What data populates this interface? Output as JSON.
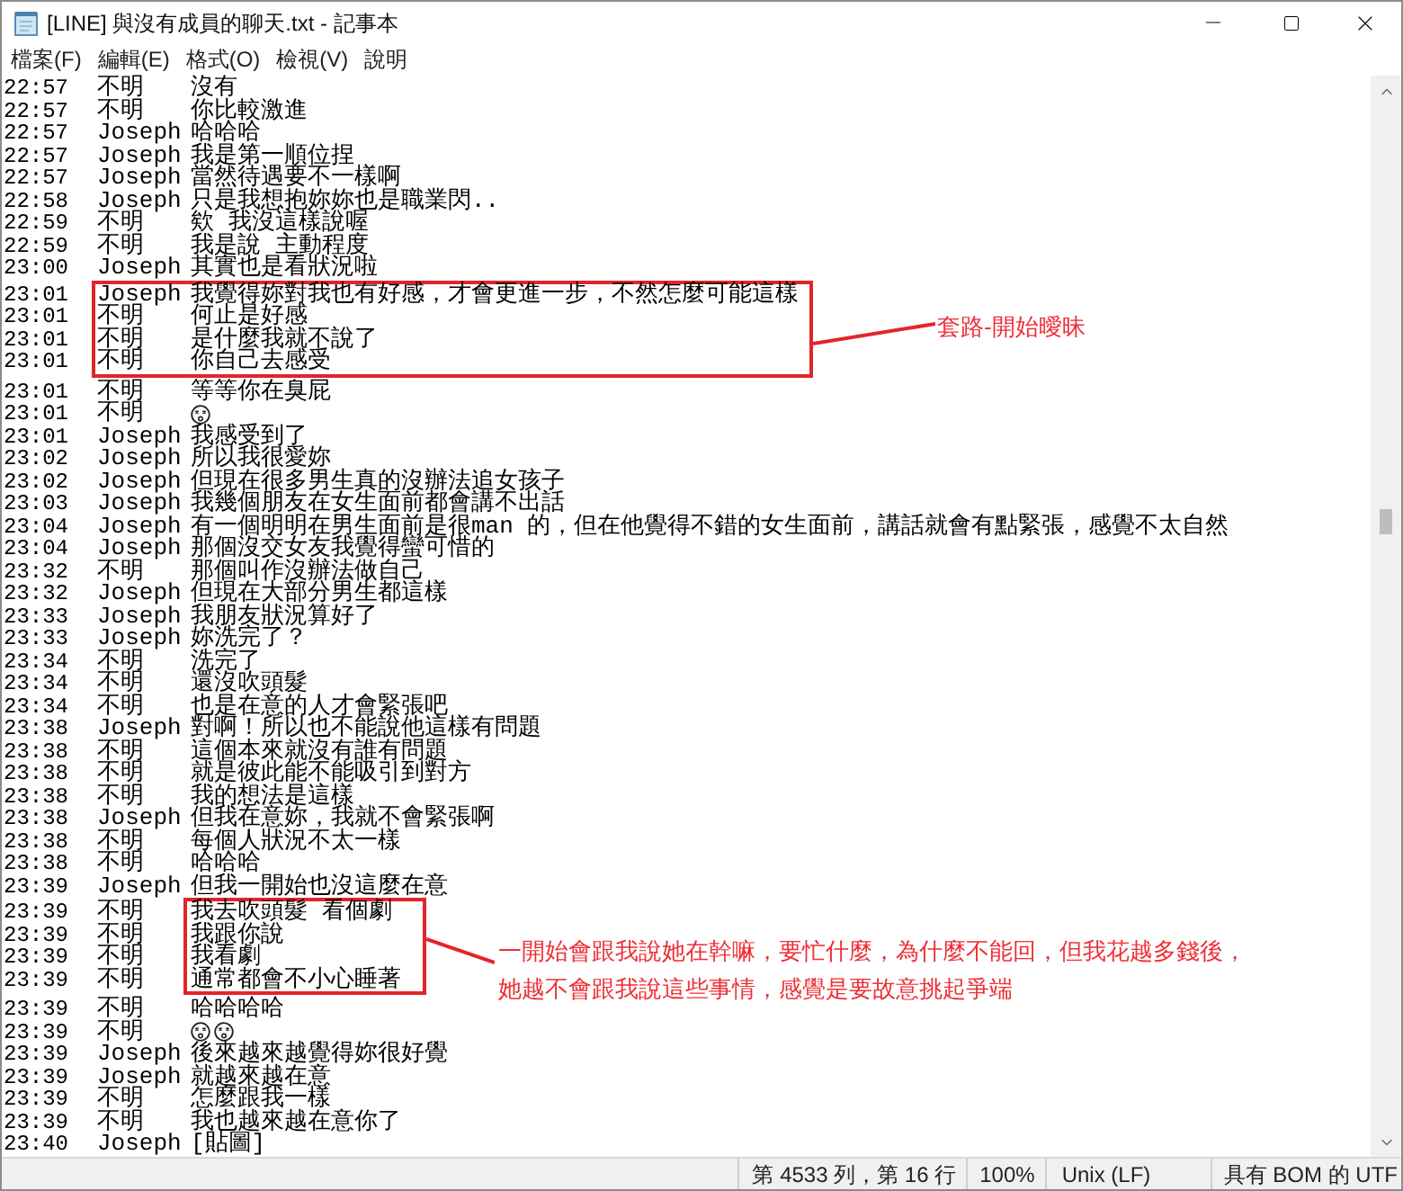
{
  "window": {
    "title": "[LINE] 與沒有成員的聊天.txt - 記事本"
  },
  "menu": [
    "檔案(F)",
    "編輯(E)",
    "格式(O)",
    "檢視(V)",
    "說明"
  ],
  "text_area": {
    "blocks": [
      {
        "kind": "plain",
        "lines": [
          {
            "kind": "text",
            "time": "22:57",
            "sender": "不明",
            "text": "沒有"
          },
          {
            "kind": "text",
            "time": "22:57",
            "sender": "不明",
            "text": "你比較激進"
          },
          {
            "kind": "text",
            "time": "22:57",
            "sender": "Joseph",
            "text": "哈哈哈"
          },
          {
            "kind": "text",
            "time": "22:57",
            "sender": "Joseph",
            "text": "我是第一順位捏"
          },
          {
            "kind": "text",
            "time": "22:57",
            "sender": "Joseph",
            "text": "當然待遇要不一樣啊"
          },
          {
            "kind": "text",
            "time": "22:58",
            "sender": "Joseph",
            "text": "只是我想抱妳妳也是職業閃.."
          },
          {
            "kind": "text",
            "time": "22:59",
            "sender": "不明",
            "text": "欸 我沒這樣說喔"
          },
          {
            "kind": "text",
            "time": "22:59",
            "sender": "不明",
            "text": "我是說 主動程度"
          },
          {
            "kind": "text",
            "time": "23:00",
            "sender": "Joseph",
            "text": "其實也是看狀況啦"
          }
        ]
      },
      {
        "kind": "frame",
        "note": [
          "套路-開始曖昧"
        ],
        "lines": [
          {
            "kind": "text",
            "time": "23:01",
            "sender": "Joseph",
            "text": "我覺得妳對我也有好感，才會更進一步，不然怎麼可能這樣"
          },
          {
            "kind": "text",
            "time": "23:01",
            "sender": "不明",
            "text": "何止是好感"
          },
          {
            "kind": "text",
            "time": "23:01",
            "sender": "不明",
            "text": "是什麼我就不說了"
          },
          {
            "kind": "text",
            "time": "23:01",
            "sender": "不明",
            "text": "你自己去感受"
          }
        ]
      },
      {
        "kind": "plain",
        "lines": [
          {
            "kind": "text",
            "time": "23:01",
            "sender": "不明",
            "text": "等等你在臭屁"
          },
          {
            "kind": "emoji",
            "time": "23:01",
            "sender": "不明",
            "emoji": [
              {
                "kind": "face"
              }
            ]
          },
          {
            "kind": "text",
            "time": "23:01",
            "sender": "Joseph",
            "text": "我感受到了"
          },
          {
            "kind": "text",
            "time": "23:02",
            "sender": "Joseph",
            "text": "所以我很愛妳"
          },
          {
            "kind": "text",
            "time": "23:02",
            "sender": "Joseph",
            "text": "但現在很多男生真的沒辦法追女孩子"
          },
          {
            "kind": "text",
            "time": "23:03",
            "sender": "Joseph",
            "text": "我幾個朋友在女生面前都會講不出話"
          },
          {
            "kind": "text",
            "time": "23:04",
            "sender": "Joseph",
            "text": "有一個明明在男生面前是很man 的，但在他覺得不錯的女生面前，講話就會有點緊張，感覺不太自然"
          },
          {
            "kind": "text",
            "time": "23:04",
            "sender": "Joseph",
            "text": "那個沒交女友我覺得蠻可惜的"
          },
          {
            "kind": "text",
            "time": "23:32",
            "sender": "不明",
            "text": "那個叫作沒辦法做自己"
          },
          {
            "kind": "text",
            "time": "23:32",
            "sender": "Joseph",
            "text": "但現在大部分男生都這樣"
          },
          {
            "kind": "text",
            "time": "23:33",
            "sender": "Joseph",
            "text": "我朋友狀況算好了"
          },
          {
            "kind": "text",
            "time": "23:33",
            "sender": "Joseph",
            "text": "妳洗完了？"
          },
          {
            "kind": "text",
            "time": "23:34",
            "sender": "不明",
            "text": "洗完了"
          },
          {
            "kind": "text",
            "time": "23:34",
            "sender": "不明",
            "text": "還沒吹頭髮"
          },
          {
            "kind": "text",
            "time": "23:34",
            "sender": "不明",
            "text": "也是在意的人才會緊張吧"
          },
          {
            "kind": "text",
            "time": "23:38",
            "sender": "Joseph",
            "text": "對啊！所以也不能說他這樣有問題"
          },
          {
            "kind": "text",
            "time": "23:38",
            "sender": "不明",
            "text": "這個本來就沒有誰有問題"
          },
          {
            "kind": "text",
            "time": "23:38",
            "sender": "不明",
            "text": "就是彼此能不能吸引到對方"
          },
          {
            "kind": "text",
            "time": "23:38",
            "sender": "不明",
            "text": "我的想法是這樣"
          },
          {
            "kind": "text",
            "time": "23:38",
            "sender": "Joseph",
            "text": "但我在意妳，我就不會緊張啊"
          },
          {
            "kind": "text",
            "time": "23:38",
            "sender": "不明",
            "text": "每個人狀況不太一樣"
          },
          {
            "kind": "text",
            "time": "23:38",
            "sender": "不明",
            "text": "哈哈哈"
          },
          {
            "kind": "text",
            "time": "23:39",
            "sender": "Joseph",
            "text": "但我一開始也沒這麼在意"
          }
        ]
      },
      {
        "kind": "box",
        "note": [
          "一開始會跟我說她在幹嘛，要忙什麼，為什麼不能回，但我花越多錢後，",
          "她越不會跟我說這些事情，感覺是要故意挑起爭端"
        ],
        "lines": [
          {
            "kind": "text",
            "time": "23:39",
            "sender": "不明",
            "text": "我去吹頭髮 看個劇"
          },
          {
            "kind": "text",
            "time": "23:39",
            "sender": "不明",
            "text": "我跟你說"
          },
          {
            "kind": "text",
            "time": "23:39",
            "sender": "不明",
            "text": "我看劇"
          },
          {
            "kind": "text",
            "time": "23:39",
            "sender": "不明",
            "text": "通常都會不小心睡著"
          }
        ]
      },
      {
        "kind": "plain",
        "lines": [
          {
            "kind": "text",
            "time": "23:39",
            "sender": "不明",
            "text": "哈哈哈哈"
          },
          {
            "kind": "emoji",
            "time": "23:39",
            "sender": "不明",
            "emoji": [
              {
                "kind": "face"
              },
              {
                "kind": "face"
              }
            ]
          },
          {
            "kind": "text",
            "time": "23:39",
            "sender": "Joseph",
            "text": "後來越來越覺得妳很好覺"
          },
          {
            "kind": "text",
            "time": "23:39",
            "sender": "Joseph",
            "text": "就越來越在意"
          },
          {
            "kind": "text",
            "time": "23:39",
            "sender": "不明",
            "text": "怎麼跟我一樣"
          },
          {
            "kind": "text",
            "time": "23:39",
            "sender": "不明",
            "text": "我也越來越在意你了"
          },
          {
            "kind": "text",
            "time": "23:40",
            "sender": "Joseph",
            "text": "[貼圖]"
          }
        ]
      }
    ]
  },
  "status_bar": [
    "第 4533 列，第 16 行",
    "100%",
    "Unix (LF)",
    "具有 BOM 的 UTF"
  ]
}
